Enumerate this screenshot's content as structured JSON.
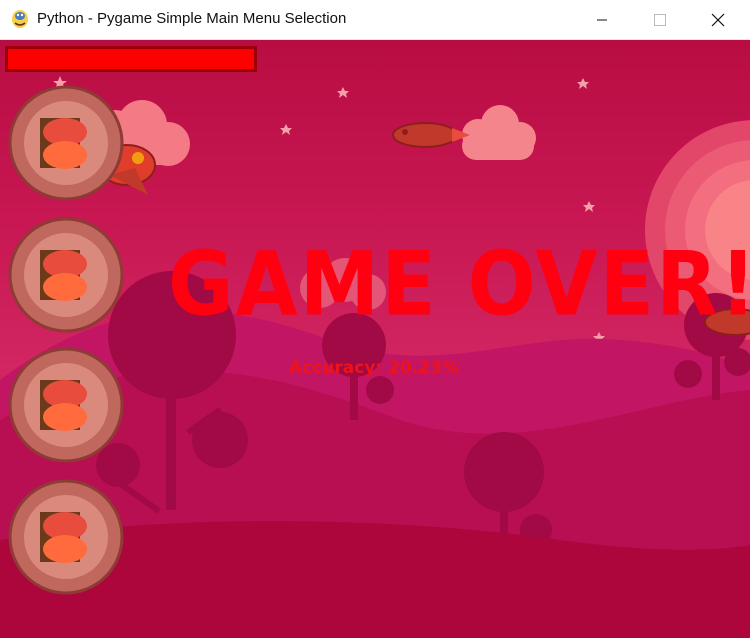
{
  "window": {
    "title": "Python - Pygame Simple Main Menu Selection",
    "icon": "python-snake-icon",
    "controls": [
      "minimize-icon",
      "maximize-icon",
      "close-icon"
    ]
  },
  "game": {
    "health_percent": 100,
    "game_over_text": "GAME OVER!",
    "accuracy_label": "Accuracy:",
    "accuracy_value": "20.23%",
    "plant_count": 4
  },
  "colors": {
    "background": "#c0124d",
    "health_bar": "#ff0000",
    "game_over_text": "#ff0010"
  }
}
